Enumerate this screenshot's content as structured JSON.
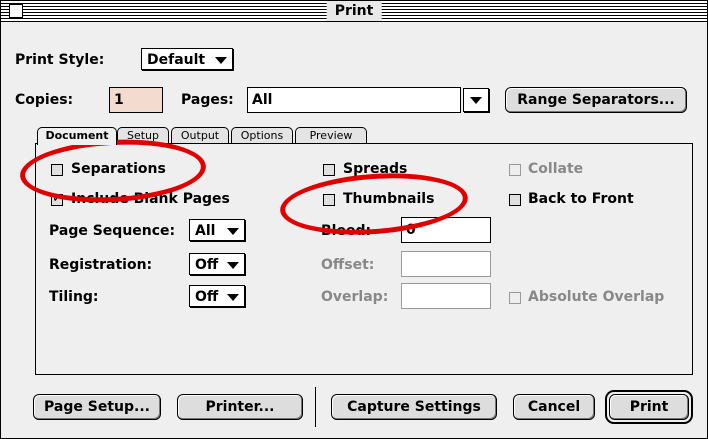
{
  "window": {
    "title": "Print"
  },
  "print_style": {
    "label": "Print Style:",
    "value": "Default"
  },
  "copies": {
    "label": "Copies:",
    "value": "1"
  },
  "pages": {
    "label": "Pages:",
    "value": "All"
  },
  "range_separators_label": "Range Separators...",
  "tabs": [
    {
      "label": "Document",
      "active": true
    },
    {
      "label": "Setup"
    },
    {
      "label": "Output"
    },
    {
      "label": "Options"
    },
    {
      "label": "Preview"
    }
  ],
  "document_tab": {
    "separations": {
      "label": "Separations",
      "checked": false
    },
    "include_blank_pages": {
      "label": "Include Blank Pages",
      "checked": true
    },
    "page_sequence": {
      "label": "Page Sequence:",
      "value": "All"
    },
    "registration": {
      "label": "Registration:",
      "value": "Off"
    },
    "tiling": {
      "label": "Tiling:",
      "value": "Off"
    },
    "spreads": {
      "label": "Spreads",
      "checked": false
    },
    "thumbnails": {
      "label": "Thumbnails",
      "checked": false
    },
    "bleed": {
      "label": "Bleed:",
      "value": "0\""
    },
    "offset": {
      "label": "Offset:",
      "value": ""
    },
    "overlap": {
      "label": "Overlap:",
      "value": ""
    },
    "collate": {
      "label": "Collate",
      "checked": false,
      "disabled": true
    },
    "back_to_front": {
      "label": "Back to Front",
      "checked": false
    },
    "absolute_overlap": {
      "label": "Absolute Overlap",
      "checked": false,
      "disabled": true
    }
  },
  "buttons": {
    "page_setup": "Page Setup...",
    "printer": "Printer...",
    "capture_settings": "Capture Settings",
    "cancel": "Cancel",
    "print": "Print"
  },
  "annotation_color": "#e10000"
}
